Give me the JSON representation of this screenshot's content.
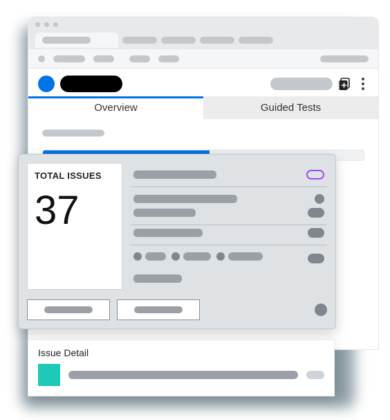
{
  "tabs": {
    "overview": "Overview",
    "guided": "Guided Tests"
  },
  "results": {
    "total_label": "TOTAL ISSUES",
    "total_value": "37"
  },
  "detail": {
    "title": "Issue Detail"
  },
  "colors": {
    "accent": "#0073e6",
    "swatch": "#1fc9b7",
    "badge_outline": "#9b4dff"
  }
}
